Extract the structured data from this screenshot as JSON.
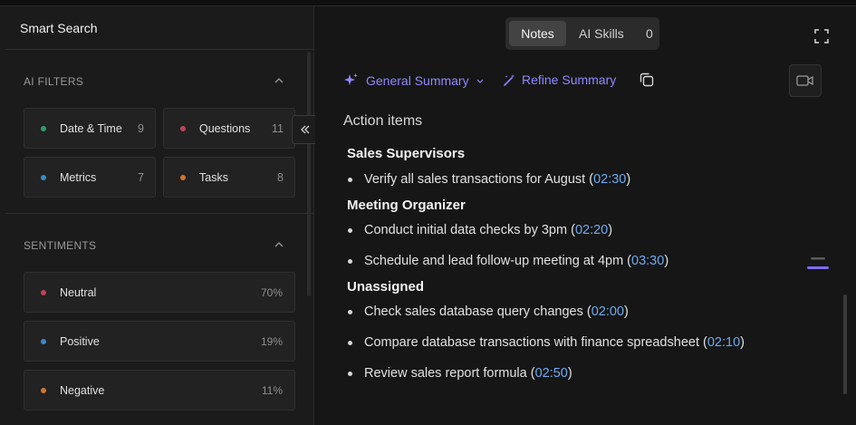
{
  "sidebar": {
    "title": "Smart Search",
    "ai_filters": {
      "label": "AI FILTERS",
      "items": [
        {
          "label": "Date & Time",
          "count": "9",
          "color": "#2e9e6b"
        },
        {
          "label": "Questions",
          "count": "11",
          "color": "#c2415b"
        },
        {
          "label": "Metrics",
          "count": "7",
          "color": "#3a8ac4"
        },
        {
          "label": "Tasks",
          "count": "8",
          "color": "#d0752e"
        }
      ]
    },
    "sentiments": {
      "label": "SENTIMENTS",
      "items": [
        {
          "label": "Neutral",
          "percent": "70%",
          "color": "#c2415b"
        },
        {
          "label": "Positive",
          "percent": "19%",
          "color": "#3a8ac4"
        },
        {
          "label": "Negative",
          "percent": "11%",
          "color": "#d0752e"
        }
      ]
    }
  },
  "tabs": {
    "notes": "Notes",
    "ai_skills": "AI Skills",
    "ai_skills_count": "0"
  },
  "toolbar": {
    "summary_label": "General Summary",
    "refine_label": "Refine Summary",
    "accent": "#8f87ff"
  },
  "content": {
    "heading": "Action items",
    "groups": [
      {
        "title": "Sales Supervisors",
        "items": [
          {
            "text": "Verify all sales transactions for August",
            "time": "02:30"
          }
        ]
      },
      {
        "title": "Meeting Organizer",
        "items": [
          {
            "text": "Conduct initial data checks by 3pm",
            "time": "02:20"
          },
          {
            "text": "Schedule and lead follow-up meeting at 4pm",
            "time": "03:30"
          }
        ]
      },
      {
        "title": "Unassigned",
        "items": [
          {
            "text": "Check sales database query changes",
            "time": "02:00"
          },
          {
            "text": "Compare database transactions with finance spreadsheet",
            "time": "02:10"
          },
          {
            "text": "Review sales report formula",
            "time": "02:50"
          }
        ]
      }
    ]
  }
}
